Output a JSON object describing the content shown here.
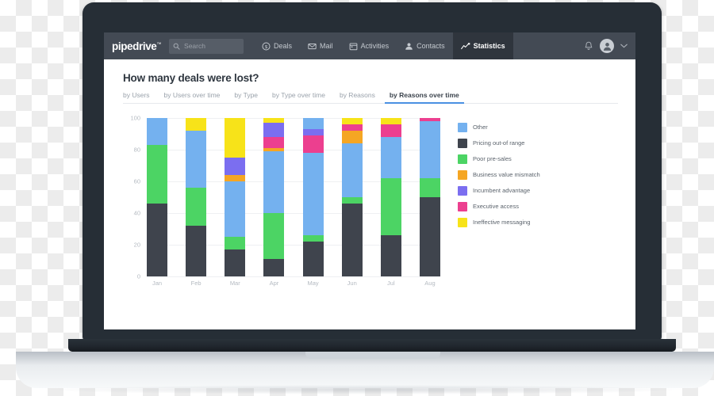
{
  "app": {
    "brand": "pipedrive",
    "brand_mark": "™"
  },
  "search": {
    "placeholder": "Search",
    "value": "",
    "icon": "search-icon"
  },
  "nav": {
    "items": [
      {
        "label": "Deals",
        "icon": "deals-dollar-icon",
        "active": false
      },
      {
        "label": "Mail",
        "icon": "mail-envelope-icon",
        "active": false
      },
      {
        "label": "Activities",
        "icon": "calendar-icon",
        "active": false
      },
      {
        "label": "Contacts",
        "icon": "person-icon",
        "active": false
      },
      {
        "label": "Statistics",
        "icon": "trend-line-icon",
        "active": true
      }
    ],
    "right": {
      "notifications_icon": "bell-icon",
      "avatar_icon": "user-avatar-icon",
      "caret_icon": "chevron-down-icon"
    }
  },
  "main": {
    "title": "How many deals were lost?",
    "tabs": [
      {
        "label": "by Users",
        "active": false
      },
      {
        "label": "by Users over time",
        "active": false
      },
      {
        "label": "by Type",
        "active": false
      },
      {
        "label": "by Type over time",
        "active": false
      },
      {
        "label": "by Reasons",
        "active": false
      },
      {
        "label": "by Reasons over time",
        "active": true
      }
    ]
  },
  "colors": {
    "other": "#74b1ef",
    "pricing_out_of_range": "#3f444d",
    "poor_pre_sales": "#4cd464",
    "business_value_mismatch": "#f5a623",
    "incumbent_advantage": "#7b6ef0",
    "executive_access": "#ec3f8f",
    "ineffective_messaging": "#f7e319",
    "accent": "#4a90e2",
    "navbar": "#434a54",
    "navbar_active": "#2f353d"
  },
  "chart_data": {
    "type": "bar",
    "stacked": true,
    "stacked_normalized": true,
    "title": "How many deals were lost?",
    "xlabel": "",
    "ylabel": "",
    "ylim": [
      0,
      100
    ],
    "yticks": [
      0,
      20,
      40,
      60,
      80,
      100
    ],
    "grid": true,
    "legend_position": "right",
    "categories": [
      "Jan",
      "Feb",
      "Mar",
      "Apr",
      "May",
      "Jun",
      "Jul",
      "Aug"
    ],
    "series": [
      {
        "name": "Pricing out-of range",
        "color": "#3f444d",
        "values": [
          46,
          32,
          17,
          11,
          22,
          46,
          26,
          50
        ]
      },
      {
        "name": "Poor pre-sales",
        "color": "#4cd464",
        "values": [
          37,
          24,
          8,
          29,
          4,
          4,
          36,
          12
        ]
      },
      {
        "name": "Other",
        "color": "#74b1ef",
        "values": [
          17,
          36,
          35,
          39,
          52,
          34,
          26,
          36
        ]
      },
      {
        "name": "Business value mismatch",
        "color": "#f5a623",
        "values": [
          0,
          0,
          4,
          2,
          0,
          8,
          0,
          0
        ]
      },
      {
        "name": "Executive access",
        "color": "#ec3f8f",
        "values": [
          0,
          0,
          0,
          7,
          11,
          4,
          8,
          2
        ]
      },
      {
        "name": "Incumbent advantage",
        "color": "#7b6ef0",
        "values": [
          0,
          0,
          11,
          9,
          4,
          0,
          0,
          0
        ]
      },
      {
        "name": "Ineffective messaging",
        "color": "#f7e319",
        "values": [
          0,
          8,
          25,
          3,
          0,
          4,
          4,
          0
        ]
      },
      {
        "name": "Other (top)",
        "color": "#74b1ef",
        "values": [
          0,
          0,
          0,
          0,
          7,
          0,
          0,
          0
        ]
      }
    ],
    "stack_order": [
      "Pricing out-of range",
      "Poor pre-sales",
      "Other",
      "Business value mismatch",
      "Executive access",
      "Incumbent advantage",
      "Ineffective messaging",
      "Other (top)"
    ]
  },
  "legend": {
    "items": [
      {
        "label": "Other",
        "color": "#74b1ef"
      },
      {
        "label": "Pricing out-of range",
        "color": "#3f444d"
      },
      {
        "label": "Poor pre-sales",
        "color": "#4cd464"
      },
      {
        "label": "Business value mismatch",
        "color": "#f5a623"
      },
      {
        "label": "Incumbent advantage",
        "color": "#7b6ef0"
      },
      {
        "label": "Executive access",
        "color": "#ec3f8f"
      },
      {
        "label": "Ineffective messaging",
        "color": "#f7e319"
      }
    ]
  }
}
